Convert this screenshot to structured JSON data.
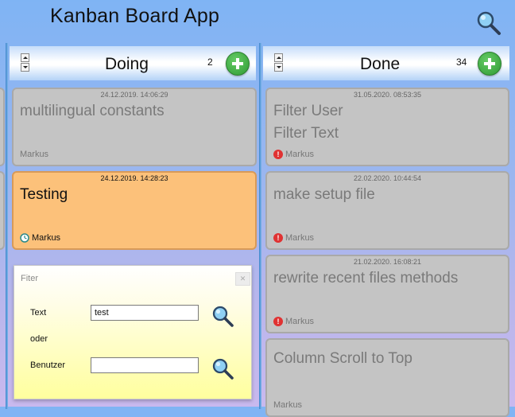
{
  "app": {
    "title": "Kanban Board App"
  },
  "columns": [
    {
      "title": "Doing",
      "count": "2",
      "cards": [
        {
          "date": "24.12.2019. 14:06:29",
          "lines": [
            "multilingual constants"
          ],
          "user": "Markus",
          "status": "none",
          "active": false
        },
        {
          "date": "24.12.2019. 14:28:23",
          "lines": [
            "Testing"
          ],
          "user": "Markus",
          "status": "clock",
          "active": true
        }
      ]
    },
    {
      "title": "Done",
      "count": "34",
      "cards": [
        {
          "date": "31.05.2020. 08:53:35",
          "lines": [
            "Filter User",
            "Filter Text"
          ],
          "user": "Markus",
          "status": "warning",
          "active": false
        },
        {
          "date": "22.02.2020. 10:44:54",
          "lines": [
            "make setup file"
          ],
          "user": "Markus",
          "status": "warning",
          "active": false
        },
        {
          "date": "21.02.2020. 16:08:21",
          "lines": [
            "rewrite recent files methods"
          ],
          "user": "Markus",
          "status": "warning",
          "active": false
        },
        {
          "date": "",
          "lines": [
            "Column Scroll to Top"
          ],
          "user": "Markus",
          "status": "none",
          "active": false
        }
      ]
    }
  ],
  "filter_dialog": {
    "title": "Fiter",
    "text_label": "Text",
    "text_value": "test",
    "or_label": "oder",
    "user_label": "Benutzer",
    "user_value": ""
  },
  "icons": {
    "search": "search-icon",
    "add": "plus-icon",
    "warning": "warning-icon",
    "clock": "clock-icon"
  },
  "colors": {
    "active_card": "#fcc17a",
    "card": "#c4c4c4",
    "add_button": "#2e9a33",
    "warning": "#e03232"
  }
}
